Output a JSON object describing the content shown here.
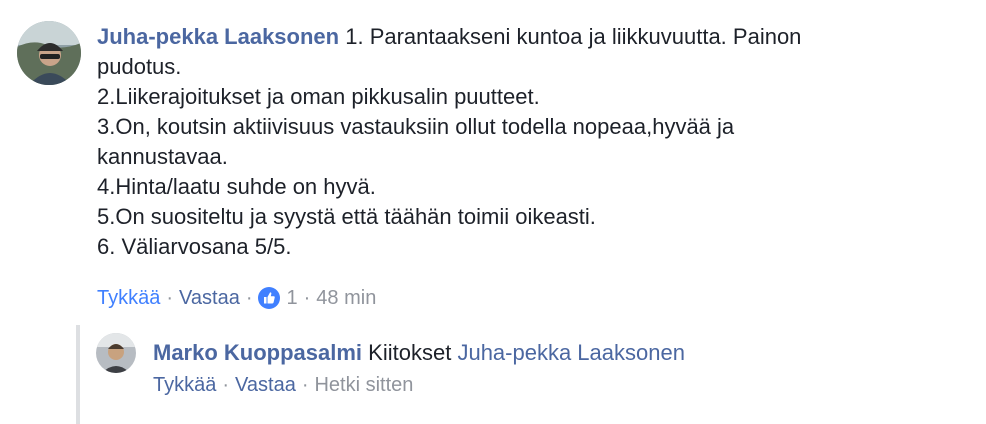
{
  "comment": {
    "author": "Juha-pekka Laaksonen",
    "first_line": "1. Parantaakseni kuntoa ja liikkuvuutta. Painon",
    "lines": [
      "pudotus.",
      "2.Liikerajoitukset ja oman pikkusalin puutteet.",
      "3.On, koutsin aktiivisuus vastauksiin ollut todella nopeaa,hyvää ja",
      "kannustavaa.",
      "4.Hinta/laatu suhde on hyvä.",
      "5.On suositeltu ja syystä että täähän toimii oikeasti.",
      "6. Väliarvosana 5/5."
    ],
    "like_label": "Tykkää",
    "reply_label": "Vastaa",
    "like_count": "1",
    "time": "48 min",
    "separator": "·"
  },
  "reply": {
    "author": "Marko Kuoppasalmi",
    "text": "Kiitokset",
    "mention": "Juha-pekka Laaksonen",
    "like_label": "Tykkää",
    "reply_label": "Vastaa",
    "time": "Hetki sitten",
    "separator": "·"
  },
  "colors": {
    "author": "#4b67a1",
    "meta": "#90949c",
    "liked": "#4080ff",
    "rail": "#dddfe2"
  },
  "icons": [
    "user-avatar",
    "thumbs-up-icon"
  ]
}
